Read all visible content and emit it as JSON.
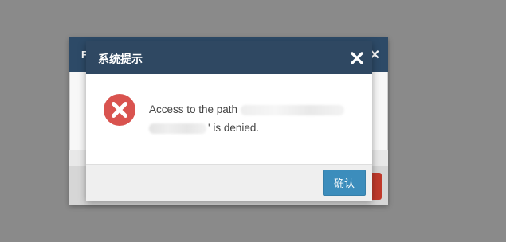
{
  "background_dialog": {
    "title_hint": "F",
    "close_hint": "✕"
  },
  "dialog": {
    "title": "系统提示",
    "message_prefix": "Access to the path",
    "message_suffix": "' is denied.",
    "confirm_label": "确认",
    "icon": "error-circle-icon",
    "close_icon": "close-icon"
  },
  "colors": {
    "header": "#2f4862",
    "error_icon": "#d9534f",
    "confirm_button": "#3c8dbc",
    "overlay": "#8a8a8a"
  }
}
